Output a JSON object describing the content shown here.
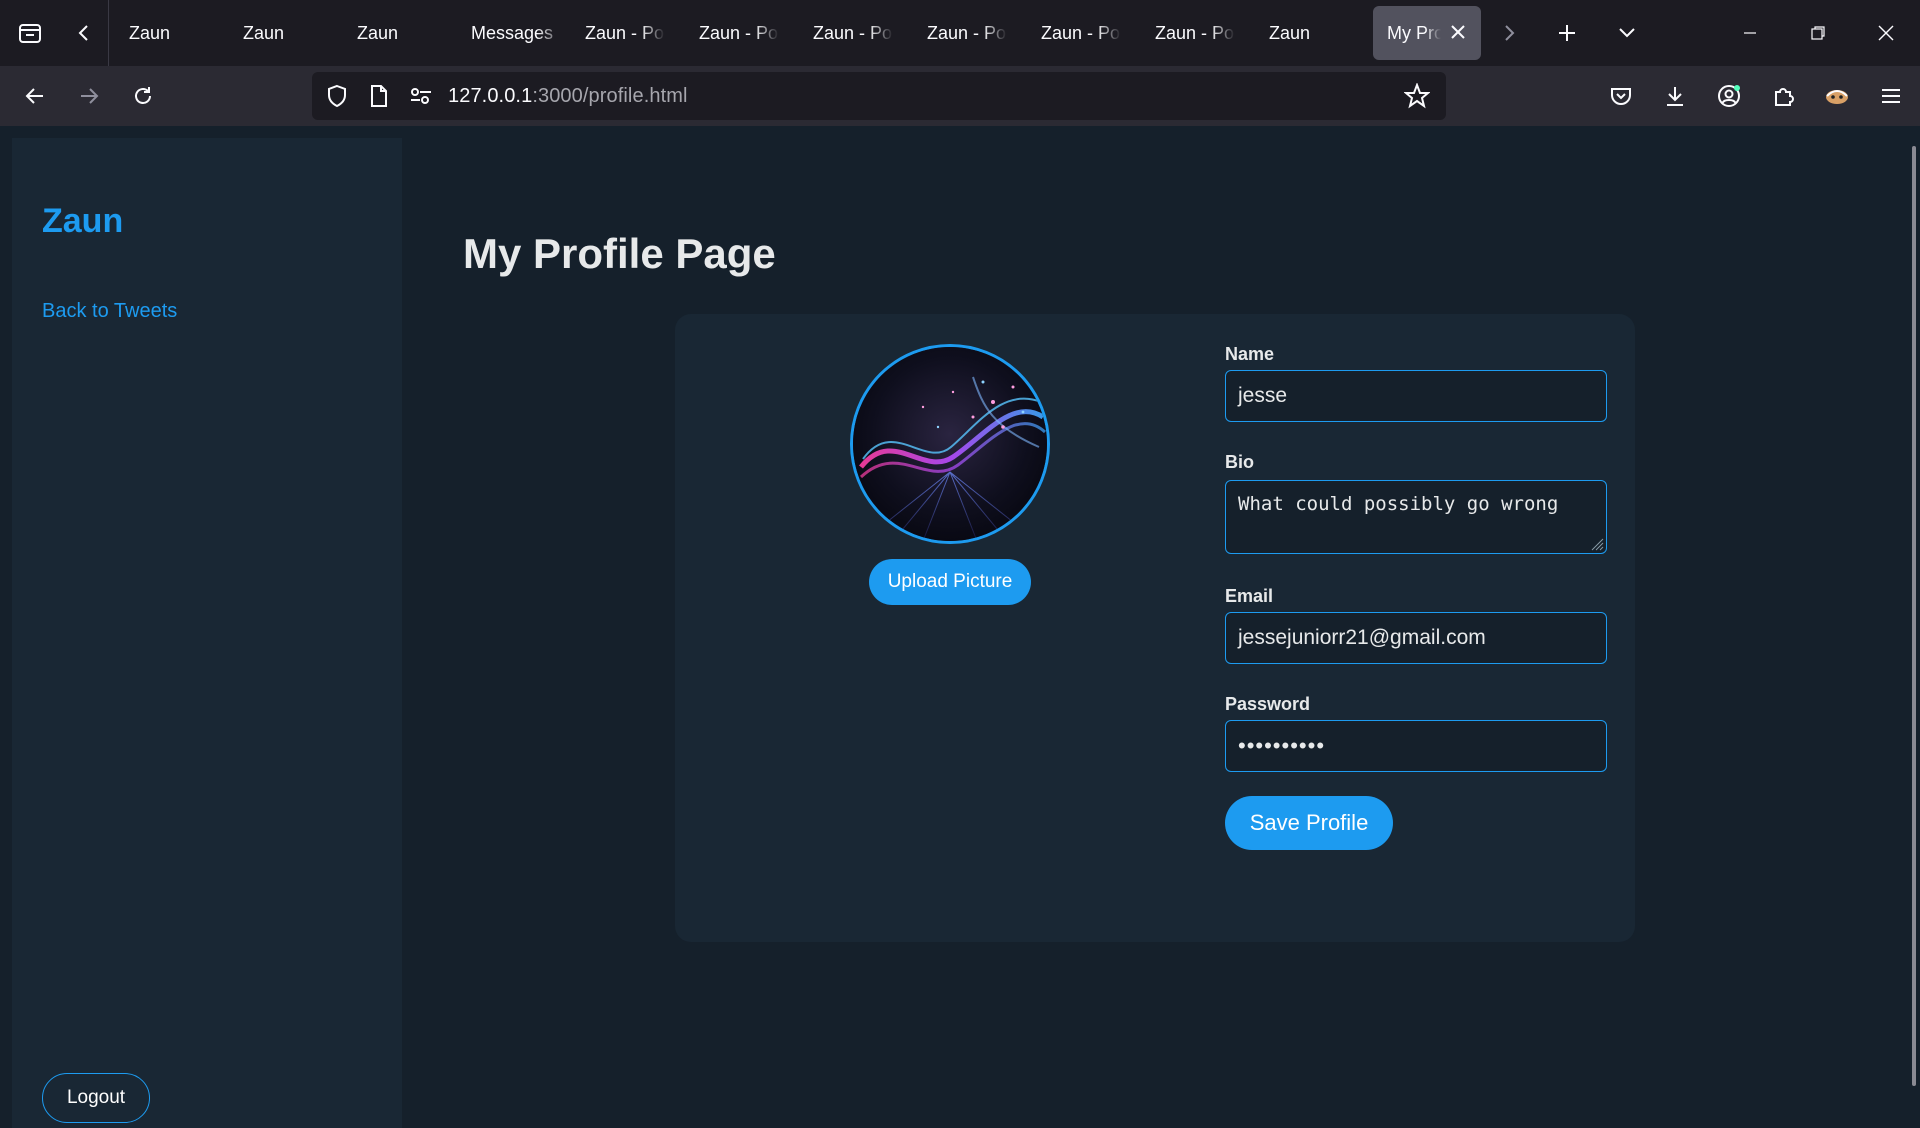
{
  "browser": {
    "tabs": [
      {
        "label": "Zaun"
      },
      {
        "label": "Zaun"
      },
      {
        "label": "Zaun"
      },
      {
        "label": "Messages"
      },
      {
        "label": "Zaun - Po"
      },
      {
        "label": "Zaun - Po"
      },
      {
        "label": "Zaun - Po"
      },
      {
        "label": "Zaun - Po"
      },
      {
        "label": "Zaun - Po"
      },
      {
        "label": "Zaun - Po"
      },
      {
        "label": "Zaun"
      }
    ],
    "active_tab": {
      "label": "My Pro"
    },
    "url": {
      "host": "127.0.0.1",
      "rest": ":3000/profile.html"
    }
  },
  "sidebar": {
    "brand": "Zaun",
    "back_link": "Back to Tweets",
    "logout": "Logout"
  },
  "main": {
    "title": "My Profile Page",
    "upload_button": "Upload Picture",
    "form": {
      "name_label": "Name",
      "name_value": "jesse",
      "bio_label": "Bio",
      "bio_value": "What could possibly go wrong",
      "email_label": "Email",
      "email_value": "jessejuniorr21@gmail.com",
      "password_label": "Password",
      "password_value": "••••••••••",
      "save_button": "Save Profile"
    }
  },
  "colors": {
    "accent": "#1d9bf0",
    "page_bg": "#15202b",
    "panel_bg": "#192734"
  }
}
